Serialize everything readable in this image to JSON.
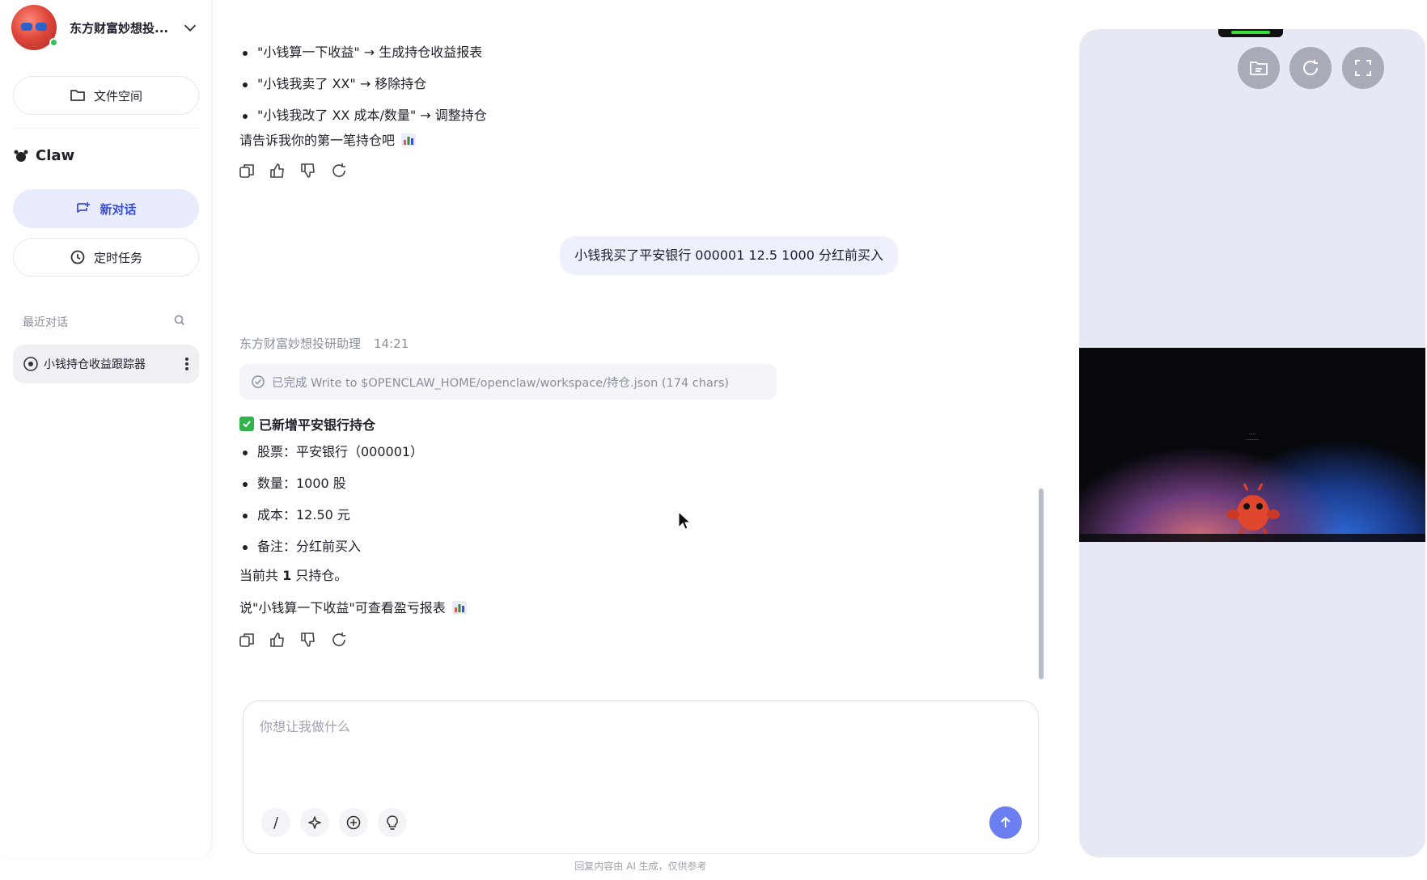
{
  "sidebar": {
    "brand_name": "东方财富妙想投...",
    "file_space_label": "文件空间",
    "section_title": "Claw",
    "new_chat_label": "新对话",
    "scheduled_label": "定时任务",
    "recent_label": "最近对话",
    "conversations": [
      {
        "title": "小钱持仓收益跟踪器"
      }
    ]
  },
  "chat": {
    "top_bullets": [
      "\"小钱算一下收益\" → 生成持仓收益报表",
      "\"小钱我卖了 XX\" → 移除持仓",
      "\"小钱我改了 XX 成本/数量\" → 调整持仓"
    ],
    "prompt_first_holding": "请告诉我你的第一笔持仓吧",
    "user_message": "小钱我买了平安银行 000001 12.5 1000 分红前买入",
    "assistant_name": "东方财富妙想投研助理",
    "assistant_time": "14:21",
    "tool_status": "已完成 Write to $OPENCLAW_HOME/openclaw/workspace/持仓.json (174 chars)",
    "result_title": "已新增平安银行持仓",
    "result_items": [
      "股票：平安银行（000001）",
      "数量：1000 股",
      "成本：12.50 元",
      "备注：分红前买入"
    ],
    "summary_prefix": "当前共 ",
    "summary_count": "1",
    "summary_suffix": " 只持仓。",
    "report_hint": "说\"小钱算一下收益\"可查看盈亏报表"
  },
  "composer": {
    "placeholder": "你想让我做什么",
    "value": "",
    "slash_label": "/"
  },
  "disclaimer": "回复内容由 AI 生成，仅供参考",
  "colors": {
    "accent": "#6b7ff0",
    "active_nav_bg": "#e9ecfd",
    "panel_bg": "#e6e8f4",
    "success": "#2fb34a"
  }
}
